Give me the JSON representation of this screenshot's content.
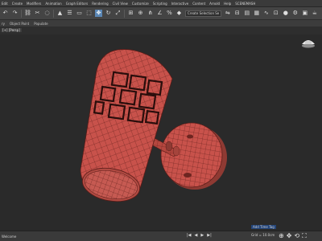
{
  "menubar": {
    "items": [
      "Edit",
      "Create",
      "Modifiers",
      "Animation",
      "Graph Editors",
      "Rendering",
      "Civil View",
      "Customize",
      "Scripting",
      "Interactive",
      "Content",
      "Arnold",
      "Help",
      "SCENEMASH"
    ]
  },
  "toolbar": {
    "selection_set_placeholder": "Create Selection Se",
    "icons": [
      "undo-icon",
      "redo-icon",
      "link-icon",
      "unlink-icon",
      "bind-icon",
      "select-icon",
      "select-by-name-icon",
      "rect-select-icon",
      "window-crossing-icon",
      "move-icon",
      "rotate-icon",
      "scale-icon"
    ]
  },
  "ribbon": {
    "items": [
      "ry",
      "Object Paint",
      "Populate"
    ]
  },
  "viewport": {
    "label": "[+] [Persp]",
    "view_cube_label": "Home",
    "model_color": "#c8524b",
    "wire_color": "#5a1c18",
    "pattern_color": "#2a0e0c"
  },
  "status": {
    "left_text": "Welcome",
    "coords_text": "Grid = 10.0cm",
    "add_time_tag": "Add Time Tag",
    "time_controls": [
      "|◀",
      "◀",
      "▶",
      "▶|"
    ]
  }
}
